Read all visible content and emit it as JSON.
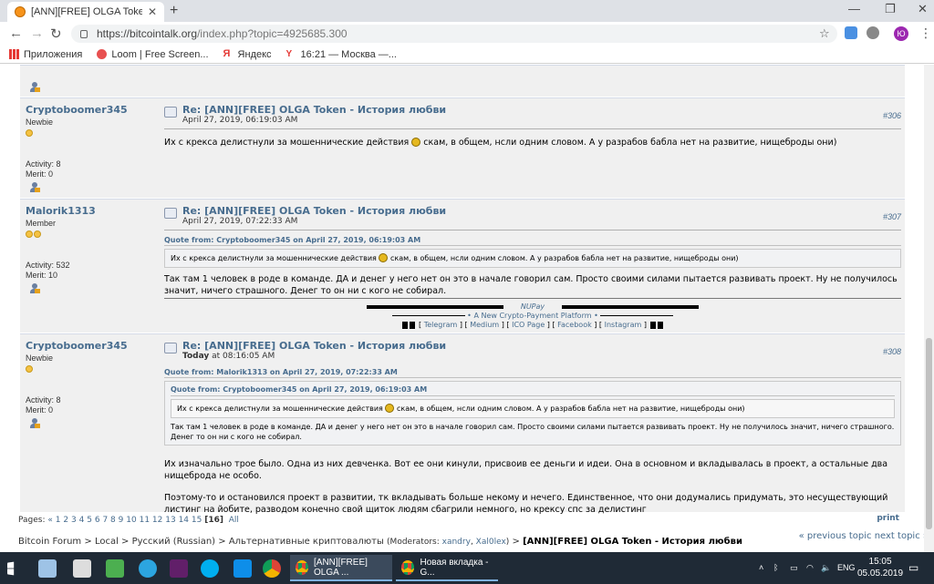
{
  "browser": {
    "tab_title": "[ANN][FREE] OLGA Token - Истори",
    "url_host": "https://bitcointalk.org",
    "url_path": "/index.php?topic=4925685.300",
    "avatar_letter": "Ю",
    "bookmarks": [
      {
        "label": "Приложения"
      },
      {
        "label": "Loom | Free Screen..."
      },
      {
        "label": "Яндекс"
      },
      {
        "label": "16:21 — Москва —..."
      }
    ]
  },
  "posts": [
    {
      "author": "Cryptoboomer345",
      "rank": "Newbie",
      "activity": "Activity: 8",
      "merit": "Merit: 0",
      "subject": "Re: [ANN][FREE] OLGA Token - История любви",
      "date": "April 27, 2019, 06:19:03 AM",
      "number": "#306",
      "text_before": "Их с крекса делистнули за мошеннические действия",
      "text_after": "скам, в общем, нсли одним словом. А у разрабов бабла нет на развитие, нищеброды они)"
    },
    {
      "author": "Malorik1313",
      "rank": "Member",
      "activity": "Activity: 532",
      "merit": "Merit: 10",
      "subject": "Re: [ANN][FREE] OLGA Token - История любви",
      "date": "April 27, 2019, 07:22:33 AM",
      "number": "#307",
      "quote_header": "Quote from: Cryptoboomer345 on April 27, 2019, 06:19:03 AM",
      "quote_before": "Их с крекса делистнули за мошеннические действия",
      "quote_after": "скам, в общем, нсли одним словом. А у разрабов бабла нет на развитие, нищеброды они)",
      "text": "Так там 1 человек в роде в команде. ДА и денег у него нет он это в начале говорил сам. Просто своими силами пытается развивать проект. Ну не получилось значит, ничего страшного. Денег то он ни с кого не собирал.",
      "signature": {
        "brand": "NUPay",
        "tagline": "A New Crypto-Payment Platform",
        "links": [
          "Telegram",
          "Medium",
          "ICO Page",
          "Facebook",
          "Instagram"
        ]
      }
    },
    {
      "author": "Cryptoboomer345",
      "rank": "Newbie",
      "activity": "Activity: 8",
      "merit": "Merit: 0",
      "subject": "Re: [ANN][FREE] OLGA Token - История любви",
      "date_bold": "Today",
      "date_rest": "at 08:16:05 AM",
      "number": "#308",
      "quote_header": "Quote from: Malorik1313 on April 27, 2019, 07:22:33 AM",
      "inner_quote_header": "Quote from: Cryptoboomer345 on April 27, 2019, 06:19:03 AM",
      "inner_quote_before": "Их с крекса делистнули за мошеннические действия",
      "inner_quote_after": "скам, в общем, нсли одним словом. А у разрабов бабла нет на развитие, нищеброды они)",
      "quote_text": "Так там 1 человек в роде в команде. ДА и денег у него нет он это в начале говорил сам. Просто своими силами пытается развивать проект. Ну не получилось значит, ничего страшного. Денег то он ни с кого не собирал.",
      "text1": "Их изначально трое было. Одна из них девченка. Вот ее они  кинули, присвоив ее деньги и идеи. Она в основном и вкладывалась в проект, а остальные два нищеброда не особо.",
      "text2": "Поэтому-то и остановился проект в развитии, тк вкладывать больше некому и нечего. Единственное, что они додумались придумать, это несуществующий листинг на йобите, разводом конечно свой щиток людям сбагрили немного, но крексу спс за делистинг"
    }
  ],
  "pagination": {
    "label": "Pages:",
    "prev": "«",
    "pages": [
      "1",
      "2",
      "3",
      "4",
      "5",
      "6",
      "7",
      "8",
      "9",
      "10",
      "11",
      "12",
      "13",
      "14",
      "15"
    ],
    "current": "[16]",
    "all": "All",
    "print": "print"
  },
  "topic_nav": {
    "prev": "« previous topic",
    "next": "next topic »"
  },
  "breadcrumb": {
    "items": [
      "Bitcoin Forum",
      "Local",
      "Русский (Russian)",
      "Альтернативные криптовалюты"
    ],
    "mods_label": "(Moderators:",
    "mods": [
      "xandry",
      "Xal0lex"
    ],
    "mods_close": ")",
    "current": "[ANN][FREE] OLGA Token - История любви"
  },
  "taskbar": {
    "apps": [
      {
        "label": "[ANN][FREE] OLGA ..."
      },
      {
        "label": "Новая вкладка - G..."
      }
    ],
    "lang": "ENG",
    "time": "15:05",
    "date": "05.05.2019"
  }
}
